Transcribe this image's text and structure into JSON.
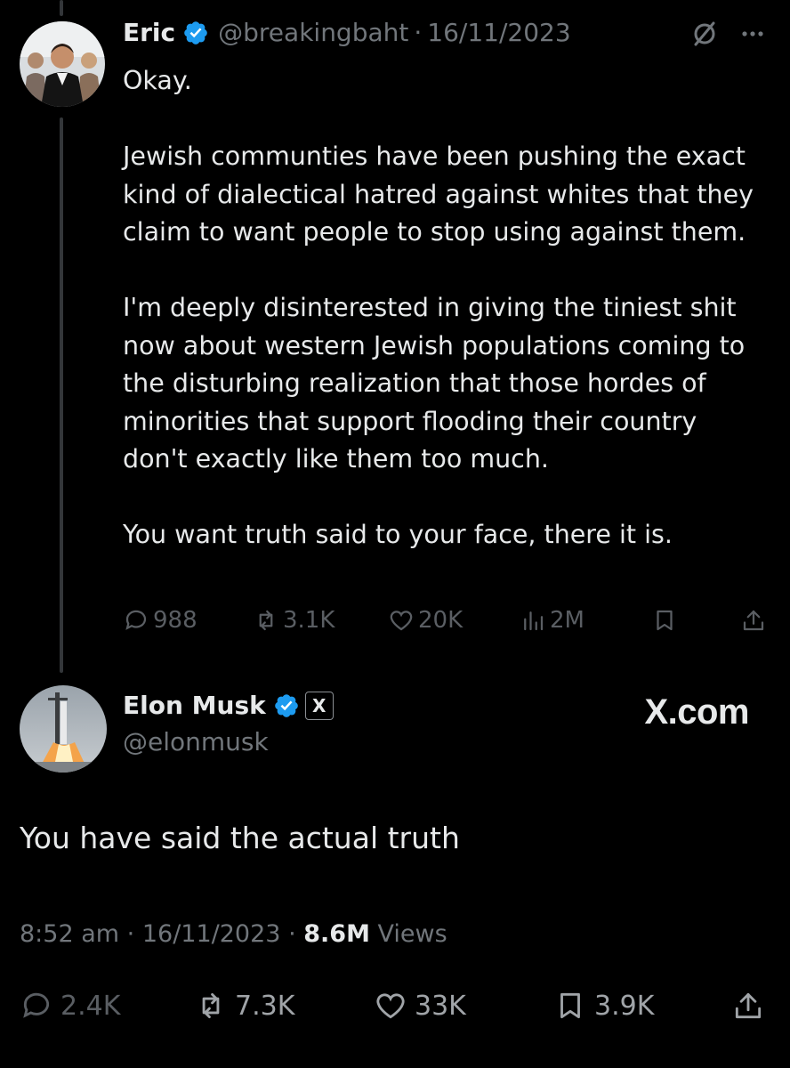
{
  "tweet": {
    "author_name": "Eric",
    "author_handle": "@breakingbaht",
    "separator": "·",
    "date": "16/11/2023",
    "text": "Okay.\n\nJewish communties have been pushing the exact kind of dialectical hatred against whites that they claim to want people to stop using against them.\n\nI'm deeply disinterested in giving the tiniest shit now about western Jewish populations coming to the disturbing realization that those hordes of minorities that support flooding their country don't exactly like them too much.\n\nYou want truth said to your face, there it is.",
    "stats": {
      "replies": "988",
      "reposts": "3.1K",
      "likes": "20K",
      "views": "2M"
    },
    "icons": [
      "no-grok-icon",
      "more-icon",
      "reply-icon",
      "repost-icon",
      "like-icon",
      "views-icon",
      "bookmark-icon",
      "share-icon"
    ]
  },
  "reply": {
    "author_name": "Elon Musk",
    "author_handle": "@elonmusk",
    "affiliate_badge": "X",
    "brand_watermark": "X.com",
    "text": "You have said the actual truth",
    "time": "8:52 am",
    "separator": "·",
    "date": "16/11/2023",
    "views_count": "8.6M",
    "views_label": "Views",
    "stats": {
      "replies": "2.4K",
      "reposts": "7.3K",
      "likes": "33K",
      "bookmarks": "3.9K"
    }
  },
  "colors": {
    "background": "#000000",
    "text": "#e7e9ea",
    "muted": "#71767b",
    "verified": "#1d9bf0",
    "thread_line": "#333639"
  }
}
